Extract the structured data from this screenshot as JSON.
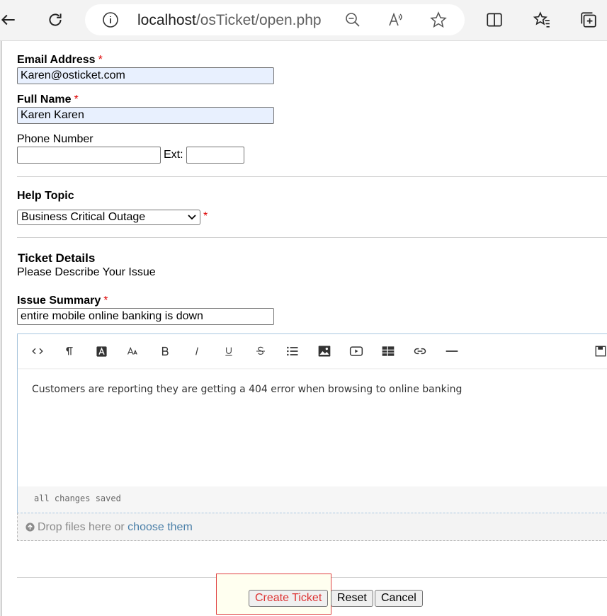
{
  "browser": {
    "url_host": "localhost",
    "url_path": "/osTicket/open.php"
  },
  "form": {
    "email": {
      "label": "Email Address",
      "required": "*",
      "value": "Karen@osticket.com"
    },
    "name": {
      "label": "Full Name",
      "required": "*",
      "value": "Karen Karen"
    },
    "phone": {
      "label": "Phone Number",
      "value": "",
      "ext_label": "Ext:",
      "ext_value": ""
    },
    "help_topic": {
      "label": "Help Topic",
      "selected": "Business Critical Outage",
      "required": "*"
    },
    "ticket_details": {
      "heading": "Ticket Details",
      "subheading": "Please Describe Your Issue"
    },
    "issue_summary": {
      "label": "Issue Summary",
      "required": "*",
      "value": "entire mobile online banking is down"
    },
    "editor": {
      "body": "Customers are reporting they are getting a 404 error when browsing to online banking",
      "status": "all changes saved"
    },
    "dropzone": {
      "text": "Drop files here or ",
      "link": "choose them"
    },
    "buttons": {
      "create": "Create Ticket",
      "reset": "Reset",
      "cancel": "Cancel"
    }
  }
}
